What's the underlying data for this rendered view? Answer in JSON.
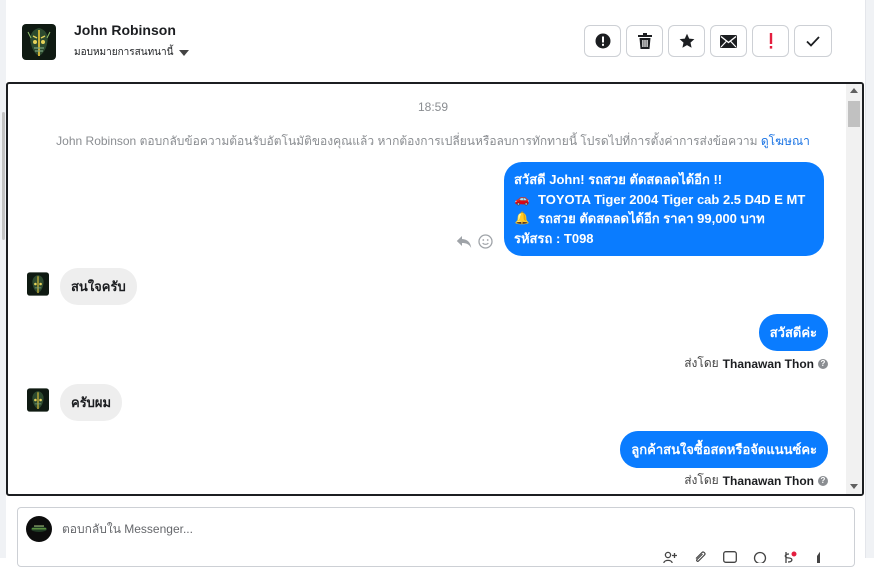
{
  "header": {
    "contact_name": "John Robinson",
    "assign_label": "มอบหมายการสนทนานี้"
  },
  "toolbar": {
    "buttons": [
      "info-icon",
      "trash-icon",
      "star-icon",
      "envelope-icon",
      "exclamation-icon",
      "checkmark-icon"
    ],
    "flag_color": "#e41e3f"
  },
  "thread": {
    "timestamp": "18:59",
    "notice_text": "John Robinson ตอบกลับข้อความต้อนรับอัตโนมัติของคุณแล้ว หากต้องการเปลี่ยนหรือลบการทักทายนี้ โปรดไปที่การตั้งค่าการส่งข้อความ",
    "notice_link": "ดูโฆษณา",
    "messages": [
      {
        "direction": "outgoing",
        "lines": [
          {
            "emoji": "",
            "text": "สวัสดี John! รถสวย ตัดสดลดได้อีก !!"
          },
          {
            "emoji": "🚗",
            "text": "TOYOTA Tiger 2004 Tiger cab 2.5 D4D E MT"
          },
          {
            "emoji": "🔔",
            "text": "รถสวย ตัดสดลดได้อีก ราคา 99,000 บาท"
          },
          {
            "emoji": "",
            "text": "รหัสรถ : T098"
          }
        ]
      },
      {
        "direction": "incoming",
        "text": "สนใจครับ"
      },
      {
        "direction": "outgoing",
        "text": "สวัสดีค่ะ",
        "sent_by_prefix": "ส่งโดย",
        "sent_by_name": "Thanawan Thon"
      },
      {
        "direction": "incoming",
        "text": "ครับผม"
      },
      {
        "direction": "outgoing",
        "text": "ลูกค้าสนใจซื้อสดหรือจัดแนนซ์คะ",
        "sent_by_prefix": "ส่งโดย",
        "sent_by_name": "Thanawan Thon"
      }
    ],
    "bubble_color": "#0a7cff",
    "incoming_bubble_color": "#eeeeee"
  },
  "composer": {
    "placeholder": "ตอบกลับใน Messenger..."
  }
}
